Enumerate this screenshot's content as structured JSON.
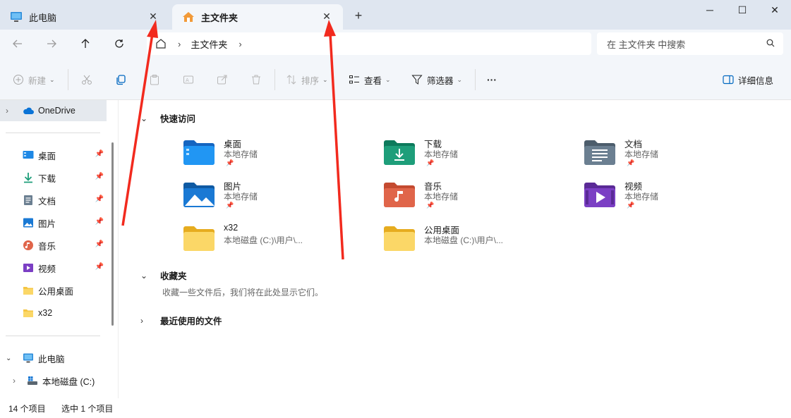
{
  "tabs": [
    {
      "label": "此电脑",
      "icon": "monitor-icon"
    },
    {
      "label": "主文件夹",
      "icon": "home-icon"
    }
  ],
  "window_controls": {
    "minimize": "─",
    "maximize": "☐",
    "close": "✕"
  },
  "nav": {
    "breadcrumb": [
      "主文件夹"
    ]
  },
  "search": {
    "placeholder": "在 主文件夹 中搜索"
  },
  "toolbar": {
    "new_label": "新建",
    "sort_label": "排序",
    "view_label": "查看",
    "filter_label": "筛选器",
    "more_label": "···",
    "details_label": "详细信息"
  },
  "sidebar": {
    "onedrive": "OneDrive",
    "pinned": [
      {
        "label": "桌面",
        "icon": "desktop-folder-icon",
        "pinned": true
      },
      {
        "label": "下载",
        "icon": "download-icon",
        "pinned": true
      },
      {
        "label": "文档",
        "icon": "documents-icon",
        "pinned": true
      },
      {
        "label": "图片",
        "icon": "pictures-icon",
        "pinned": true
      },
      {
        "label": "音乐",
        "icon": "music-icon",
        "pinned": true
      },
      {
        "label": "视频",
        "icon": "videos-icon",
        "pinned": true
      },
      {
        "label": "公用桌面",
        "icon": "folder-icon",
        "pinned": false
      },
      {
        "label": "x32",
        "icon": "folder-icon",
        "pinned": false
      }
    ],
    "this_pc": "此电脑",
    "local_disk": "本地磁盘 (C:)"
  },
  "main": {
    "quick_access_title": "快速访问",
    "quick_access": [
      {
        "name": "桌面",
        "sub": "本地存储",
        "pinned": true,
        "icon": "desktop-folder-icon",
        "color": "#1e88e5"
      },
      {
        "name": "下载",
        "sub": "本地存储",
        "pinned": true,
        "icon": "download-folder-icon",
        "color": "#1e9e7a"
      },
      {
        "name": "文档",
        "sub": "本地存储",
        "pinned": true,
        "icon": "documents-folder-icon",
        "color": "#6b7f91"
      },
      {
        "name": "图片",
        "sub": "本地存储",
        "pinned": true,
        "icon": "pictures-folder-icon",
        "color": "#1a79d4"
      },
      {
        "name": "音乐",
        "sub": "本地存储",
        "pinned": true,
        "icon": "music-folder-icon",
        "color": "#e0654a"
      },
      {
        "name": "视频",
        "sub": "本地存储",
        "pinned": true,
        "icon": "videos-folder-icon",
        "color": "#7b3fc4"
      },
      {
        "name": "x32",
        "sub": "本地磁盘 (C:)\\用户\\...",
        "pinned": false,
        "icon": "folder-icon",
        "color": "#f5c542"
      },
      {
        "name": "公用桌面",
        "sub": "本地磁盘 (C:)\\用户\\...",
        "pinned": false,
        "icon": "folder-icon",
        "color": "#f5c542"
      }
    ],
    "favorites_title": "收藏夹",
    "favorites_empty": "收藏一些文件后，我们将在此处显示它们。",
    "recent_title": "最近使用的文件"
  },
  "status": {
    "item_count": "14 个项目",
    "selected": "选中 1 个项目"
  },
  "colors": {
    "accent": "#0067c0",
    "annotation": "#f22a1e",
    "tabbar": "#dfe6f0"
  }
}
